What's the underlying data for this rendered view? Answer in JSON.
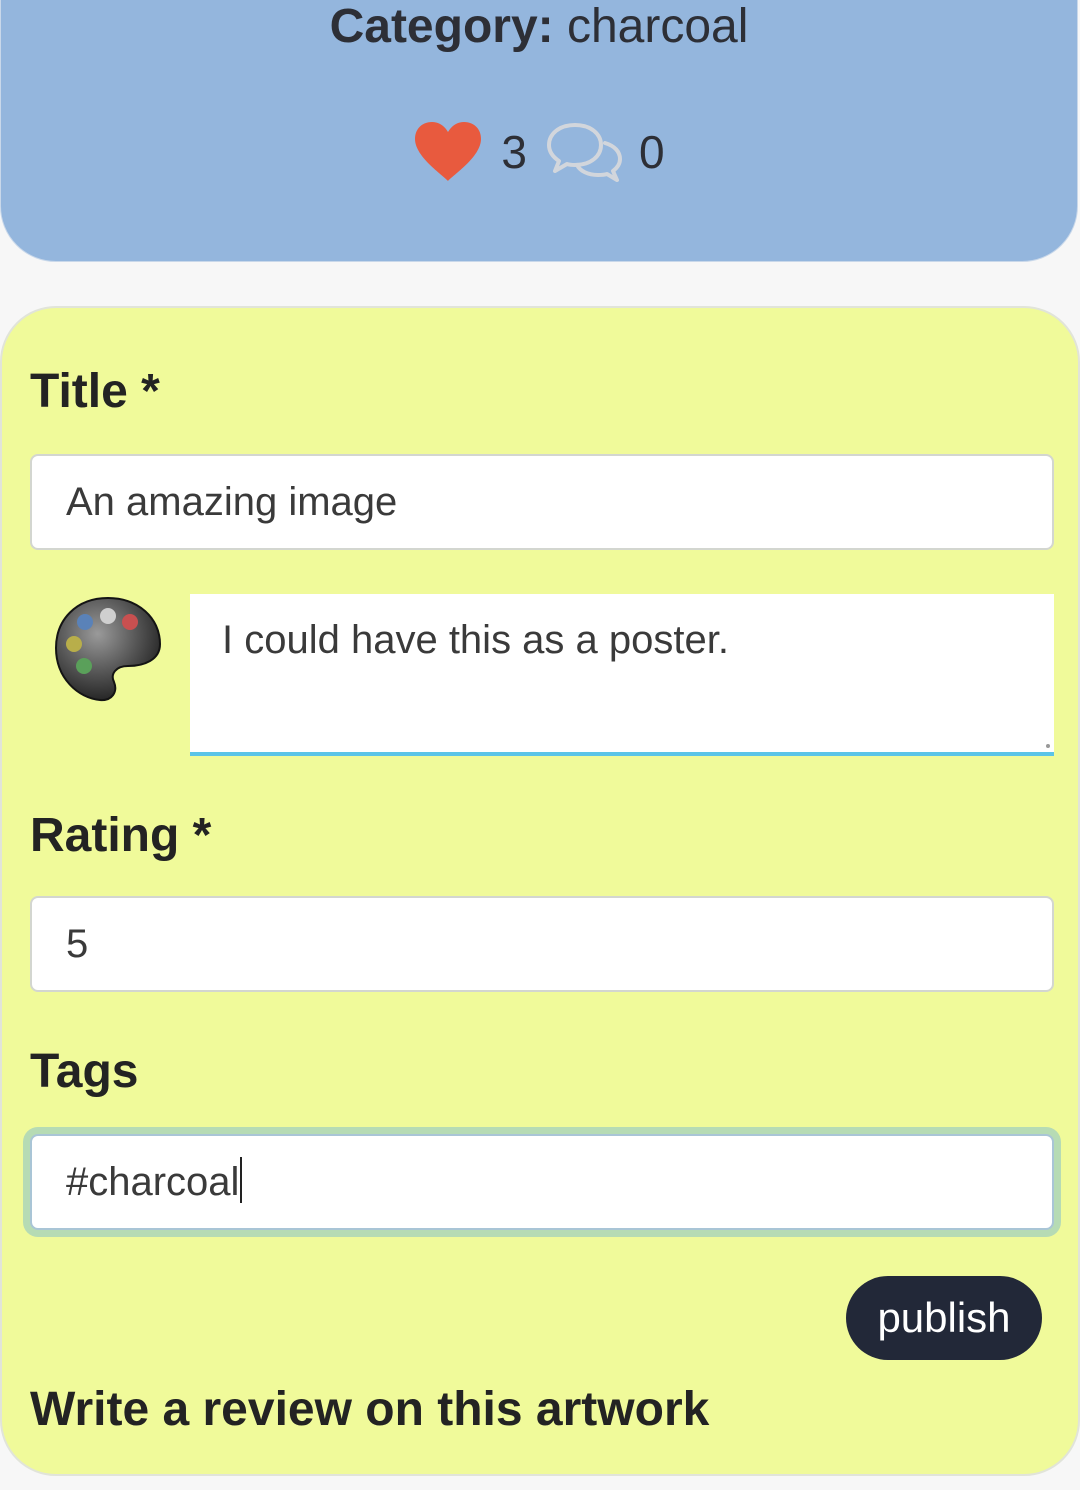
{
  "artwork": {
    "category_label": "Category:",
    "category_value": "charcoal",
    "likes": "3",
    "comments": "0"
  },
  "form": {
    "title_label": "Title *",
    "title_value": "An amazing image",
    "comment_text": "I could have this as a poster.",
    "rating_label": "Rating *",
    "rating_value": "5",
    "tags_label": "Tags",
    "tags_value": "#charcoal",
    "publish_label": "publish",
    "review_heading": "Write a review on this artwork"
  },
  "icons": {
    "heart": "heart-icon",
    "comment": "comment-bubbles-icon",
    "avatar": "palette-avatar"
  },
  "colors": {
    "info_card_bg": "#94b6dd",
    "form_card_bg": "#f0fa9a",
    "heart": "#e85a3e",
    "button_bg": "#222838",
    "focus_ring": "#b6dbb4",
    "textarea_underline": "#5bc4e8"
  }
}
